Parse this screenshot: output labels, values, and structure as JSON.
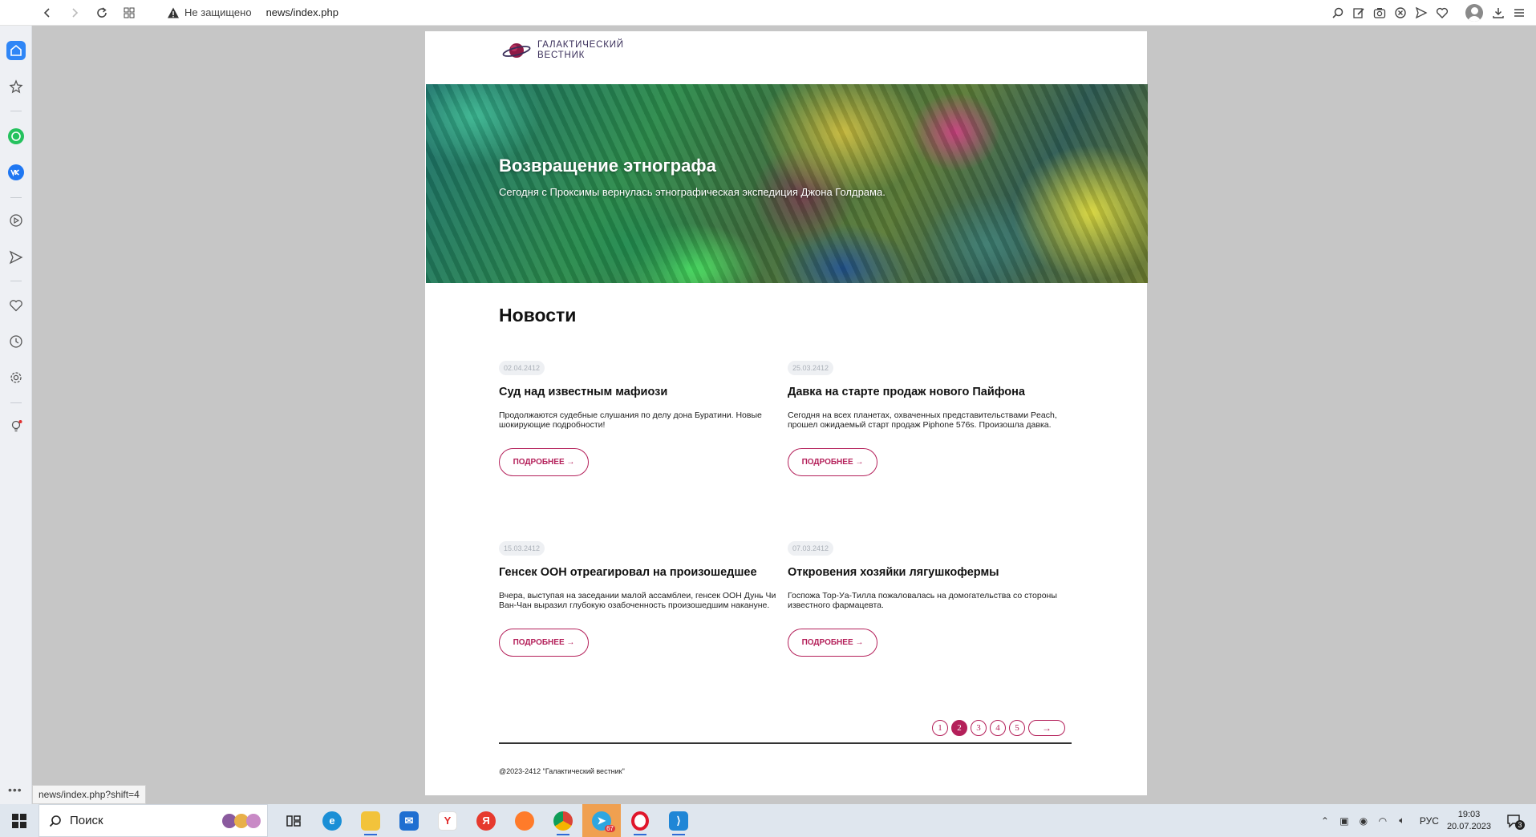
{
  "browser": {
    "insecure_label": "Не защищено",
    "url": "news/index.php",
    "status_url": "news/index.php?shift=4"
  },
  "site": {
    "logo_line1": "Галактический",
    "logo_line2": "вестник",
    "hero_title": "Возвращение этнографа",
    "hero_subtitle": "Сегодня с Проксимы вернулась этнографическая экспедиция Джона Голдрама.",
    "news_heading": "Новости",
    "more_label": "ПОДРОБНЕЕ →",
    "articles": [
      {
        "date": "02.04.2412",
        "title": "Суд над известным мафиози",
        "text": "Продолжаются судебные слушания по делу дона Буратини. Новые шокирующие подробности!"
      },
      {
        "date": "25.03.2412",
        "title": "Давка на старте продаж нового Пайфона",
        "text": "Сегодня на всех планетах, охваченных представительствами Peach, прошел ожидаемый старт продаж Piphone 576s. Произошла давка."
      },
      {
        "date": "15.03.2412",
        "title": "Генсек ООН отреагировал на произошедшее",
        "text": "Вчера, выступая на заседании малой ассамблеи, генсек ООН Дунь Чи Ван-Чан выразил глубокую озабоченность произошедшим накануне."
      },
      {
        "date": "07.03.2412",
        "title": "Откровения хозяйки лягушкофермы",
        "text": "Госпожа Тор-Уа-Тилла пожаловалась на домогательства со стороны известного фармацевта."
      }
    ],
    "pages": [
      "1",
      "2",
      "3",
      "4",
      "5"
    ],
    "active_page": "2",
    "next_label": "→",
    "footer": "@2023-2412 \"Галактический вестник\""
  },
  "taskbar": {
    "search_label": "Поиск",
    "lang": "РУС",
    "time": "19:03",
    "date": "20.07.2023",
    "telegram_badge": "67",
    "notif_count": "3"
  },
  "colors": {
    "accent": "#b4205a",
    "sidebar_active": "#2f86f6"
  }
}
